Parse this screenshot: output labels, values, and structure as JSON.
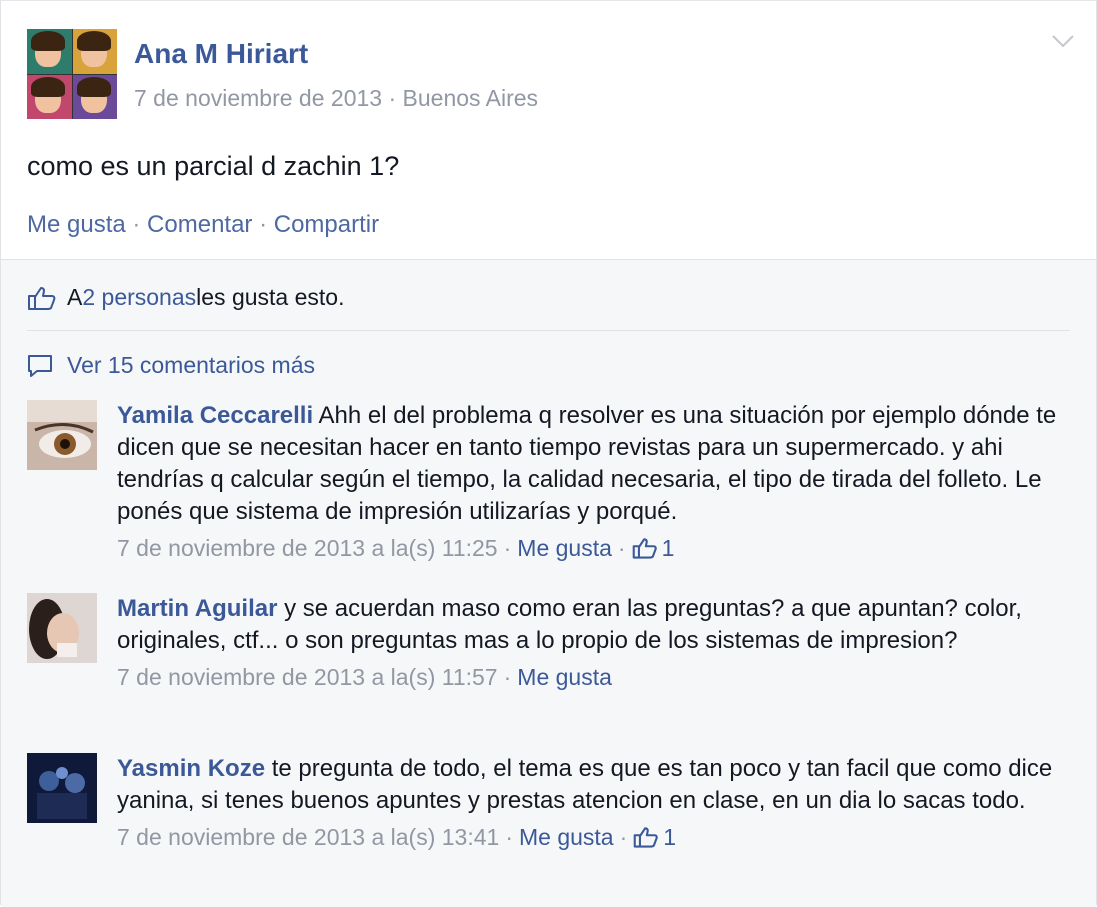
{
  "post": {
    "author": "Ana M Hiriart",
    "date": "7 de noviembre de 2013",
    "separator": " · ",
    "location": "Buenos Aires",
    "text": "como es un parcial d zachin 1?",
    "actions": {
      "like": "Me gusta",
      "comment": "Comentar",
      "share": "Compartir",
      "sep": " · "
    }
  },
  "likes": {
    "prefix": "A ",
    "count_link": "2 personas",
    "suffix": " les gusta esto."
  },
  "more_comments": "Ver 15 comentarios más",
  "comments": [
    {
      "author": "Yamila Ceccarelli",
      "text": " Ahh el del problema q resolver es una situación por ejemplo dónde te dicen que se necesitan hacer en tanto tiempo revistas para un supermercado. y ahi tendrías q calcular según el tiempo, la calidad necesaria, el tipo de tirada del folleto. Le ponés que sistema de impresión utilizarías y porqué.",
      "timestamp": "7 de noviembre de 2013 a la(s) 11:25",
      "like_label": "Me gusta",
      "like_count": "1"
    },
    {
      "author": "Martin Aguilar",
      "text": " y se acuerdan maso como eran las preguntas? a que apuntan? color, originales, ctf... o son preguntas mas a lo propio de los sistemas de impresion?",
      "timestamp": "7 de noviembre de 2013 a la(s) 11:57",
      "like_label": "Me gusta"
    },
    {
      "author": "Yasmin Koze",
      "text": " te pregunta de todo, el tema es que es tan poco y tan facil que como dice yanina, si tenes buenos apuntes y prestas atencion en clase, en un dia lo sacas todo.",
      "timestamp": "7 de noviembre de 2013 a la(s) 13:41",
      "like_label": "Me gusta",
      "like_count": "1"
    }
  ],
  "sep": " · ",
  "colors": {
    "link": "#3b5998",
    "meta": "#9197a3",
    "ufi_bg": "#f6f7f8"
  },
  "icons": [
    "chevron-down-icon",
    "thumbs-up-icon",
    "speech-bubble-icon"
  ]
}
